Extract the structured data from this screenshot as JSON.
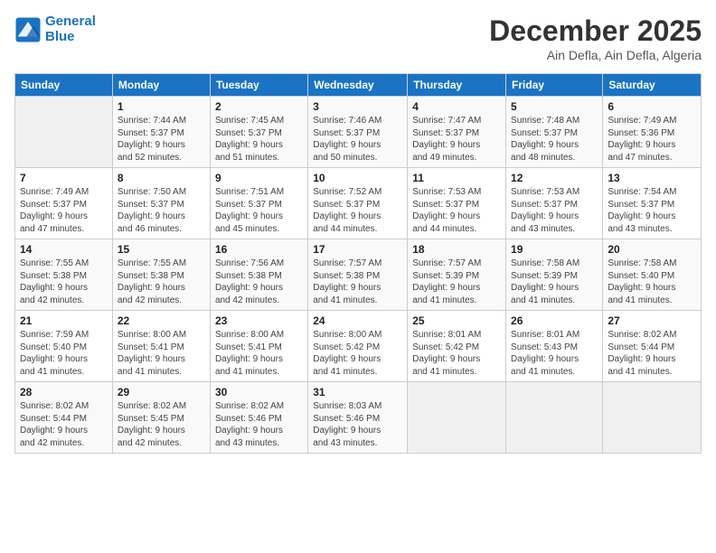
{
  "header": {
    "logo_line1": "General",
    "logo_line2": "Blue",
    "month": "December 2025",
    "location": "Ain Defla, Ain Defla, Algeria"
  },
  "days_of_week": [
    "Sunday",
    "Monday",
    "Tuesday",
    "Wednesday",
    "Thursday",
    "Friday",
    "Saturday"
  ],
  "weeks": [
    [
      {
        "day": "",
        "info": ""
      },
      {
        "day": "1",
        "info": "Sunrise: 7:44 AM\nSunset: 5:37 PM\nDaylight: 9 hours\nand 52 minutes."
      },
      {
        "day": "2",
        "info": "Sunrise: 7:45 AM\nSunset: 5:37 PM\nDaylight: 9 hours\nand 51 minutes."
      },
      {
        "day": "3",
        "info": "Sunrise: 7:46 AM\nSunset: 5:37 PM\nDaylight: 9 hours\nand 50 minutes."
      },
      {
        "day": "4",
        "info": "Sunrise: 7:47 AM\nSunset: 5:37 PM\nDaylight: 9 hours\nand 49 minutes."
      },
      {
        "day": "5",
        "info": "Sunrise: 7:48 AM\nSunset: 5:37 PM\nDaylight: 9 hours\nand 48 minutes."
      },
      {
        "day": "6",
        "info": "Sunrise: 7:49 AM\nSunset: 5:36 PM\nDaylight: 9 hours\nand 47 minutes."
      }
    ],
    [
      {
        "day": "7",
        "info": "Sunrise: 7:49 AM\nSunset: 5:37 PM\nDaylight: 9 hours\nand 47 minutes."
      },
      {
        "day": "8",
        "info": "Sunrise: 7:50 AM\nSunset: 5:37 PM\nDaylight: 9 hours\nand 46 minutes."
      },
      {
        "day": "9",
        "info": "Sunrise: 7:51 AM\nSunset: 5:37 PM\nDaylight: 9 hours\nand 45 minutes."
      },
      {
        "day": "10",
        "info": "Sunrise: 7:52 AM\nSunset: 5:37 PM\nDaylight: 9 hours\nand 44 minutes."
      },
      {
        "day": "11",
        "info": "Sunrise: 7:53 AM\nSunset: 5:37 PM\nDaylight: 9 hours\nand 44 minutes."
      },
      {
        "day": "12",
        "info": "Sunrise: 7:53 AM\nSunset: 5:37 PM\nDaylight: 9 hours\nand 43 minutes."
      },
      {
        "day": "13",
        "info": "Sunrise: 7:54 AM\nSunset: 5:37 PM\nDaylight: 9 hours\nand 43 minutes."
      }
    ],
    [
      {
        "day": "14",
        "info": "Sunrise: 7:55 AM\nSunset: 5:38 PM\nDaylight: 9 hours\nand 42 minutes."
      },
      {
        "day": "15",
        "info": "Sunrise: 7:55 AM\nSunset: 5:38 PM\nDaylight: 9 hours\nand 42 minutes."
      },
      {
        "day": "16",
        "info": "Sunrise: 7:56 AM\nSunset: 5:38 PM\nDaylight: 9 hours\nand 42 minutes."
      },
      {
        "day": "17",
        "info": "Sunrise: 7:57 AM\nSunset: 5:38 PM\nDaylight: 9 hours\nand 41 minutes."
      },
      {
        "day": "18",
        "info": "Sunrise: 7:57 AM\nSunset: 5:39 PM\nDaylight: 9 hours\nand 41 minutes."
      },
      {
        "day": "19",
        "info": "Sunrise: 7:58 AM\nSunset: 5:39 PM\nDaylight: 9 hours\nand 41 minutes."
      },
      {
        "day": "20",
        "info": "Sunrise: 7:58 AM\nSunset: 5:40 PM\nDaylight: 9 hours\nand 41 minutes."
      }
    ],
    [
      {
        "day": "21",
        "info": "Sunrise: 7:59 AM\nSunset: 5:40 PM\nDaylight: 9 hours\nand 41 minutes."
      },
      {
        "day": "22",
        "info": "Sunrise: 8:00 AM\nSunset: 5:41 PM\nDaylight: 9 hours\nand 41 minutes."
      },
      {
        "day": "23",
        "info": "Sunrise: 8:00 AM\nSunset: 5:41 PM\nDaylight: 9 hours\nand 41 minutes."
      },
      {
        "day": "24",
        "info": "Sunrise: 8:00 AM\nSunset: 5:42 PM\nDaylight: 9 hours\nand 41 minutes."
      },
      {
        "day": "25",
        "info": "Sunrise: 8:01 AM\nSunset: 5:42 PM\nDaylight: 9 hours\nand 41 minutes."
      },
      {
        "day": "26",
        "info": "Sunrise: 8:01 AM\nSunset: 5:43 PM\nDaylight: 9 hours\nand 41 minutes."
      },
      {
        "day": "27",
        "info": "Sunrise: 8:02 AM\nSunset: 5:44 PM\nDaylight: 9 hours\nand 41 minutes."
      }
    ],
    [
      {
        "day": "28",
        "info": "Sunrise: 8:02 AM\nSunset: 5:44 PM\nDaylight: 9 hours\nand 42 minutes."
      },
      {
        "day": "29",
        "info": "Sunrise: 8:02 AM\nSunset: 5:45 PM\nDaylight: 9 hours\nand 42 minutes."
      },
      {
        "day": "30",
        "info": "Sunrise: 8:02 AM\nSunset: 5:46 PM\nDaylight: 9 hours\nand 43 minutes."
      },
      {
        "day": "31",
        "info": "Sunrise: 8:03 AM\nSunset: 5:46 PM\nDaylight: 9 hours\nand 43 minutes."
      },
      {
        "day": "",
        "info": ""
      },
      {
        "day": "",
        "info": ""
      },
      {
        "day": "",
        "info": ""
      }
    ]
  ]
}
